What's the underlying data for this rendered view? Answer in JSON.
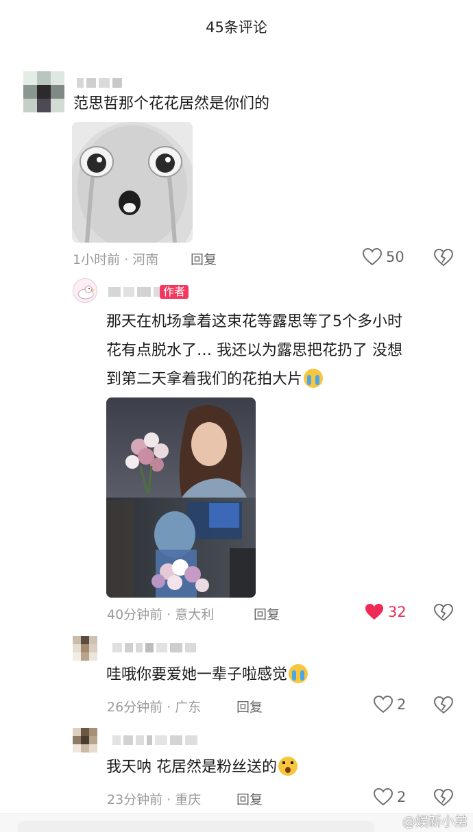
{
  "header": {
    "title": "45条评论"
  },
  "comments": [
    {
      "text": "范思哲那个花花居然是你们的",
      "time_location": "1小时前 · 河南",
      "reply_label": "回复",
      "likes": "50"
    },
    {
      "author_tag": "作者",
      "lines": [
        "那天在机场拿着这束花等露思等了5个多小时",
        "花有点脱水了… 我还以为露思把花扔了 没想",
        "到第二天拿着我们的花拍大片"
      ],
      "time_location": "40分钟前 · 意大利",
      "reply_label": "回复",
      "likes": "32"
    },
    {
      "text": "哇哦你要爱她一辈子啦感觉",
      "time_location": "26分钟前 · 广东",
      "reply_label": "回复",
      "likes": "2"
    },
    {
      "text": "我天呐 花居然是粉丝送的",
      "time_location": "23分钟前 · 重庆",
      "reply_label": "回复",
      "likes": "2"
    }
  ],
  "watermark": "@娱新小弟",
  "colors": {
    "accent_like": "#ee2b56",
    "author_tag": "#f4375f"
  },
  "icons": [
    "heart-icon",
    "heart-filled-icon",
    "dislike-broken-heart-icon",
    "crying-emoji",
    "surprised-emoji"
  ]
}
